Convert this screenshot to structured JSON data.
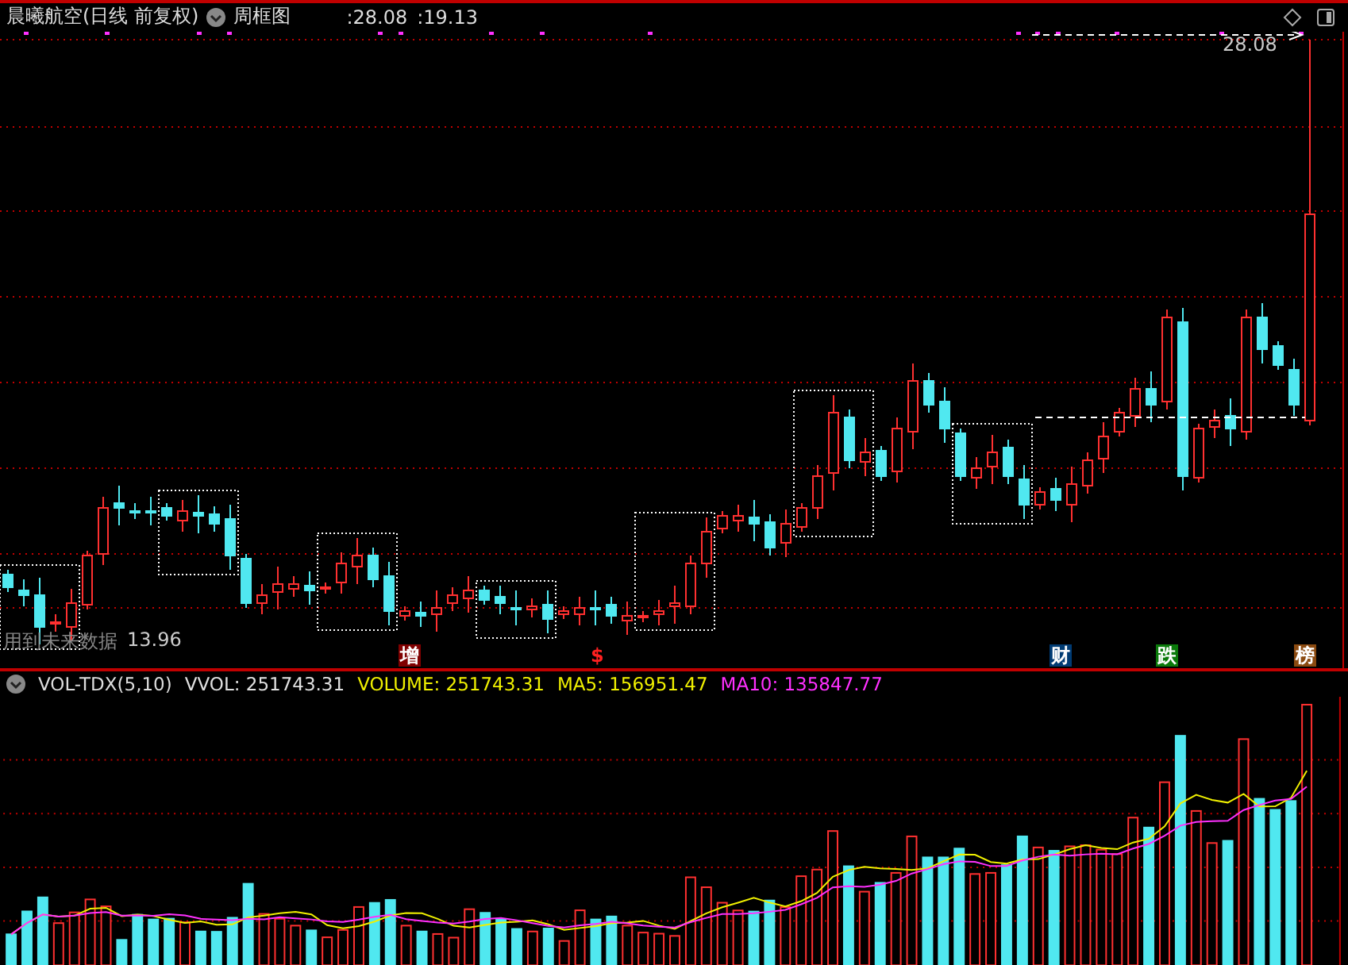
{
  "header": {
    "title": "晨曦航空(日线 前复权)",
    "view": "周框图",
    "values": [
      ":28.08",
      ":19.13"
    ]
  },
  "price_labels": {
    "high": "28.08",
    "low": "13.96",
    "warning": "用到未来数据"
  },
  "event_markers": [
    {
      "text": "增",
      "color": "#800000",
      "kind": "badge"
    },
    {
      "text": "$",
      "color": "#ff2020",
      "kind": "glyph"
    },
    {
      "text": "财",
      "color": "#003b73",
      "kind": "badge"
    },
    {
      "text": "跌",
      "color": "#0a7a0a",
      "kind": "badge"
    },
    {
      "text": "榜",
      "color": "#8b4a10",
      "kind": "badge"
    }
  ],
  "volume_header": {
    "name": "VOL-TDX(5,10)",
    "series": [
      {
        "text": "VVOL: 251743.31",
        "color": "#e0e0e0"
      },
      {
        "text": "VOLUME: 251743.31",
        "color": "#f0f000"
      },
      {
        "text": "MA5: 156951.47",
        "color": "#f0f000"
      },
      {
        "text": "MA10: 135847.77",
        "color": "#ff30ff"
      }
    ]
  }
}
